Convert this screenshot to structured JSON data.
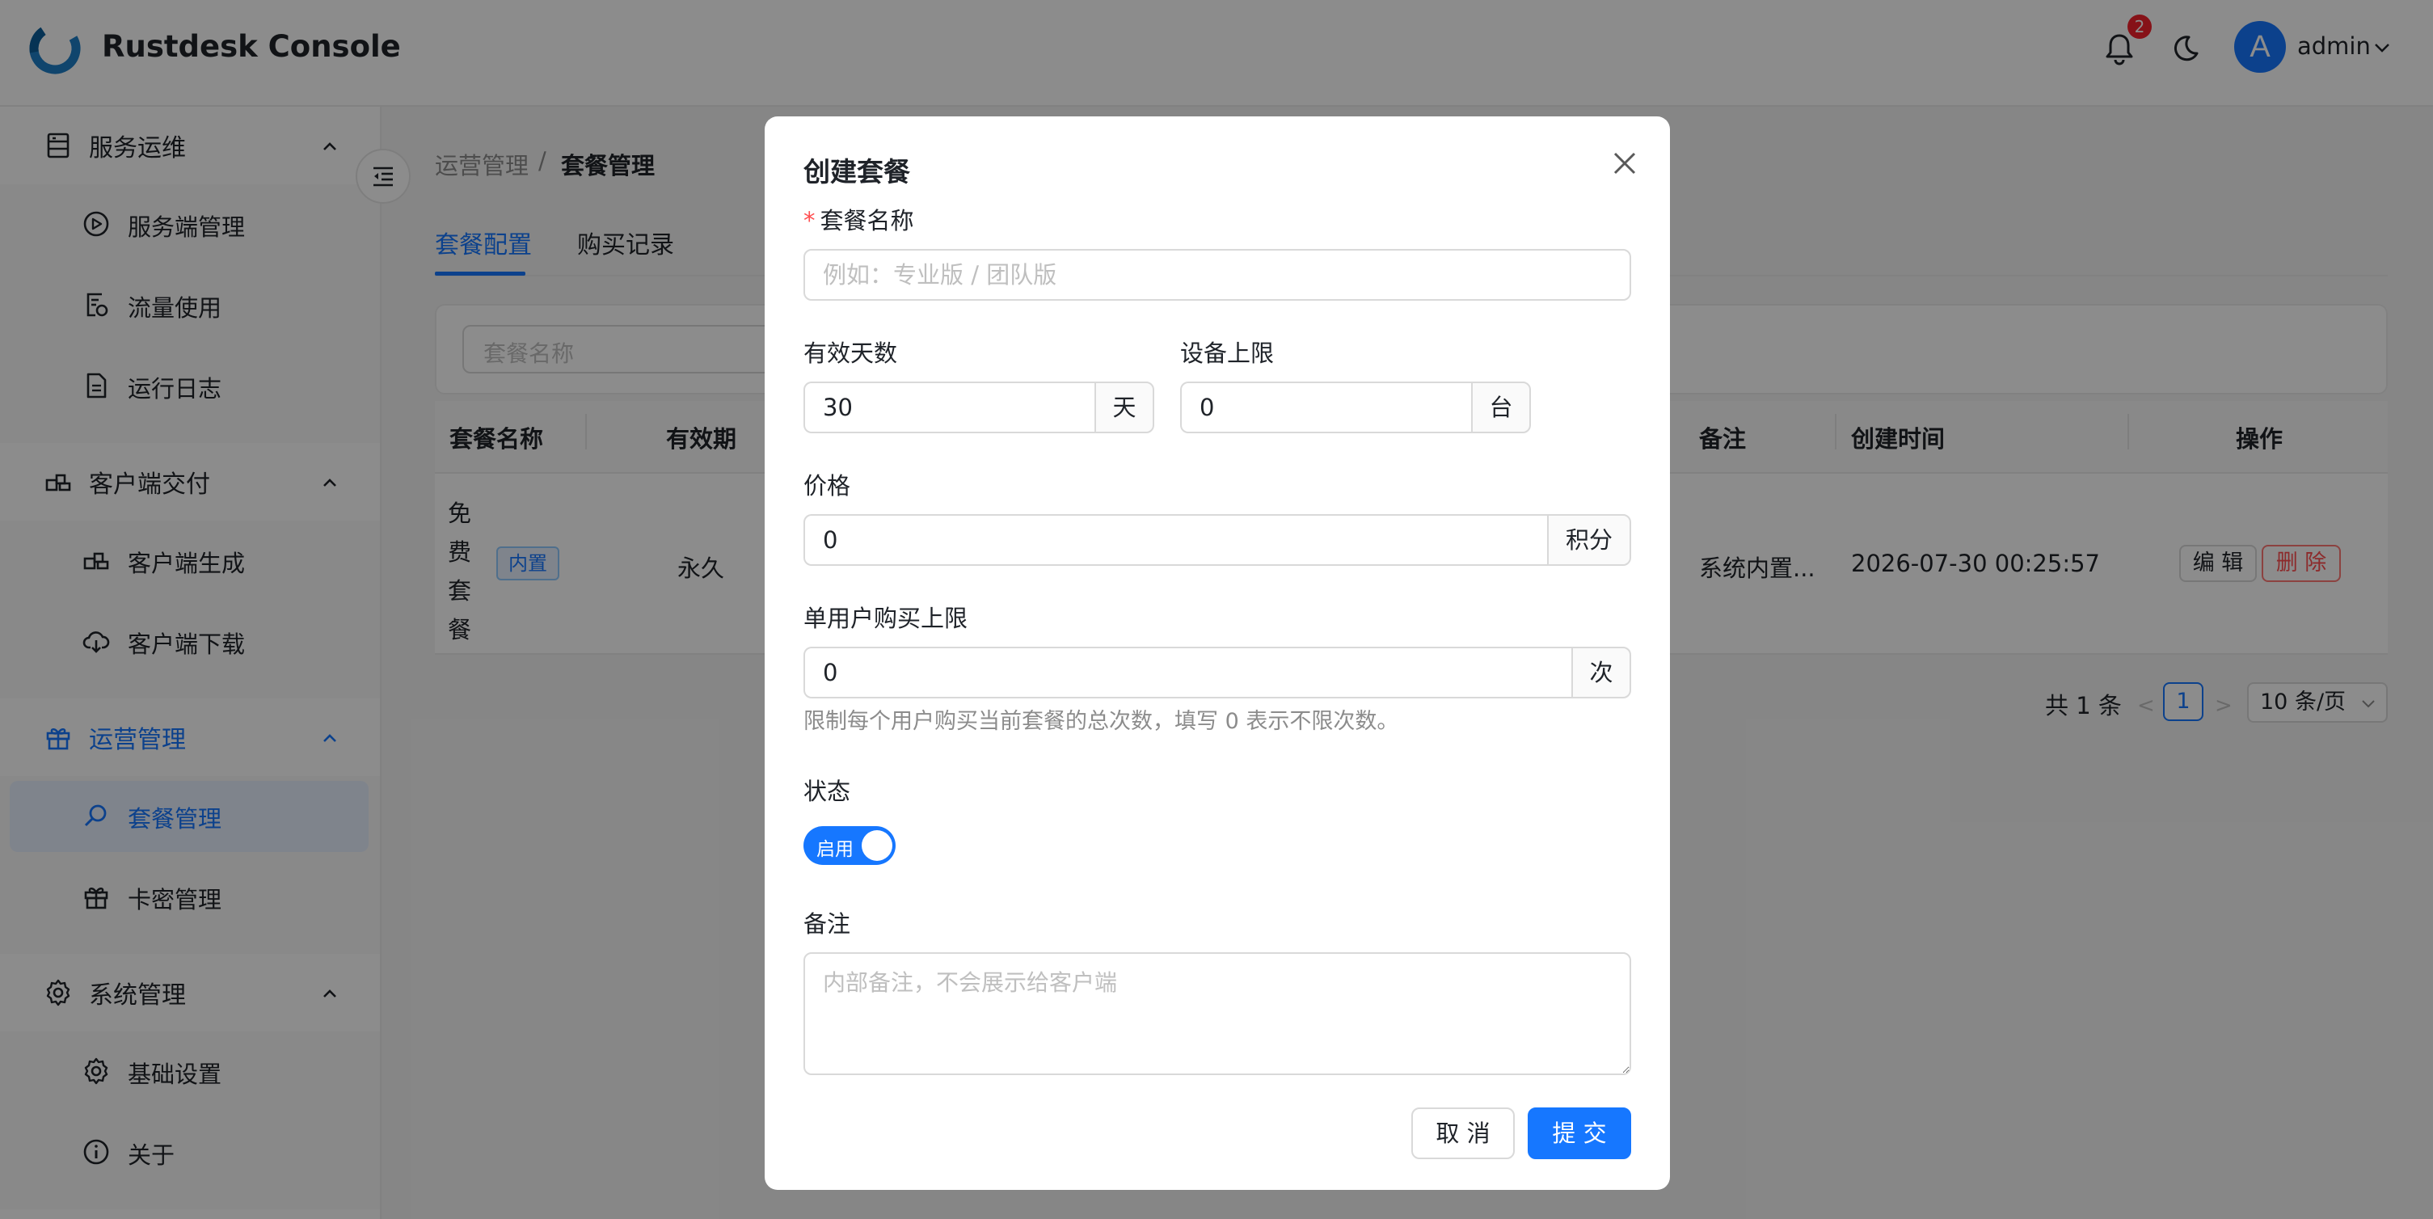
{
  "header": {
    "app_title": "Rustdesk Console",
    "notification_count": "2",
    "user_initial": "A",
    "username": "admin",
    "accent": "#1677ff"
  },
  "sidebar": {
    "groups": [
      {
        "label": "服务运维",
        "icon": "server-icon",
        "items": [
          {
            "label": "服务端管理",
            "icon": "play-circle-icon"
          },
          {
            "label": "流量使用",
            "icon": "traffic-report-icon"
          },
          {
            "label": "运行日志",
            "icon": "log-file-icon"
          }
        ]
      },
      {
        "label": "客户端交付",
        "icon": "blocks-icon",
        "items": [
          {
            "label": "客户端生成",
            "icon": "blocks-icon"
          },
          {
            "label": "客户端下载",
            "icon": "cloud-download-icon"
          }
        ]
      },
      {
        "label": "运营管理",
        "icon": "gift-icon",
        "active": true,
        "items": [
          {
            "label": "套餐管理",
            "icon": "search-icon",
            "active": true
          },
          {
            "label": "卡密管理",
            "icon": "gift-icon"
          }
        ]
      },
      {
        "label": "系统管理",
        "icon": "gear-icon",
        "items": [
          {
            "label": "基础设置",
            "icon": "gear-icon"
          },
          {
            "label": "关于",
            "icon": "info-icon"
          }
        ]
      }
    ]
  },
  "breadcrumb": {
    "parent": "运营管理",
    "separator": "/",
    "current": "套餐管理"
  },
  "tabs": [
    {
      "label": "套餐配置",
      "active": true
    },
    {
      "label": "购买记录"
    }
  ],
  "filter": {
    "placeholder": "套餐名称"
  },
  "table": {
    "columns": {
      "name": "套餐名称",
      "validity": "有效期",
      "remark": "备注",
      "created": "创建时间",
      "actions": "操作"
    },
    "rows": [
      {
        "name_chars": [
          "免",
          "费",
          "套",
          "餐"
        ],
        "tag": "内置",
        "validity": "永久",
        "remark": "系统内置...",
        "created": "2026-07-30 00:25:57",
        "edit": "编 辑",
        "delete": "删 除"
      }
    ]
  },
  "pagination": {
    "total": "共 1 条",
    "prev": "<",
    "page": "1",
    "next": ">",
    "page_size": "10 条/页"
  },
  "modal": {
    "title": "创建套餐",
    "name": {
      "label": "套餐名称",
      "required_mark": "*",
      "placeholder": "例如：专业版 / 团队版",
      "value": ""
    },
    "days": {
      "label": "有效天数",
      "value": "30",
      "suffix": "天"
    },
    "device_limit": {
      "label": "设备上限",
      "value": "0",
      "suffix": "台"
    },
    "price": {
      "label": "价格",
      "value": "0",
      "suffix": "积分"
    },
    "purchase_limit": {
      "label": "单用户购买上限",
      "value": "0",
      "suffix": "次",
      "help": "限制每个用户购买当前套餐的总次数，填写 0 表示不限次数。"
    },
    "status": {
      "label": "状态",
      "switch_text": "启用",
      "enabled": true
    },
    "remark": {
      "label": "备注",
      "placeholder": "内部备注，不会展示给客户端",
      "value": ""
    },
    "cancel_label": "取 消",
    "submit_label": "提 交"
  }
}
